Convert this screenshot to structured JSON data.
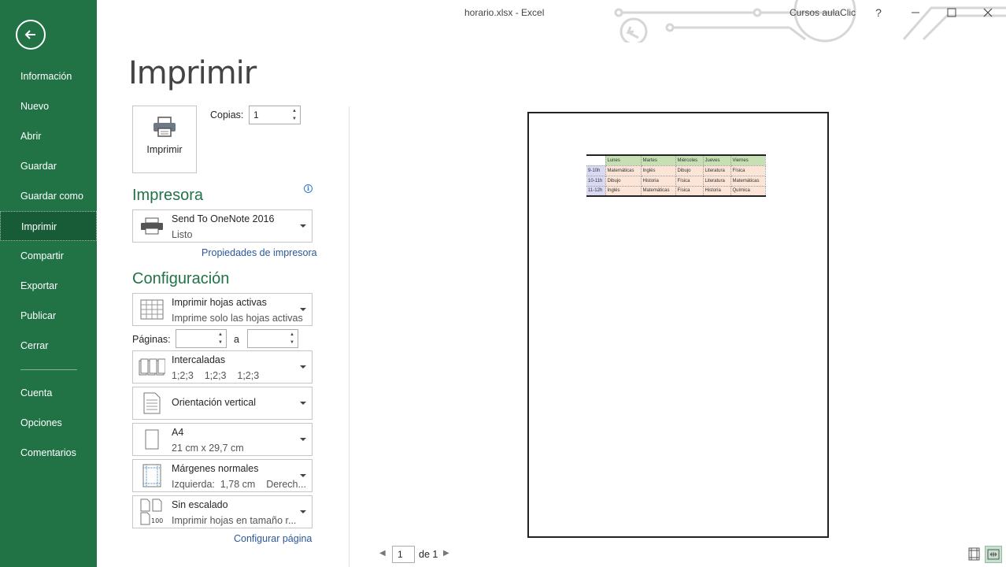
{
  "window": {
    "title": "horario.xlsx - Excel",
    "account": "Cursos aulaClic",
    "help": "?"
  },
  "sidebar": {
    "items": [
      {
        "label": "Información"
      },
      {
        "label": "Nuevo"
      },
      {
        "label": "Abrir"
      },
      {
        "label": "Guardar"
      },
      {
        "label": "Guardar como"
      },
      {
        "label": "Imprimir",
        "active": true
      },
      {
        "label": "Compartir"
      },
      {
        "label": "Exportar"
      },
      {
        "label": "Publicar"
      },
      {
        "label": "Cerrar"
      }
    ],
    "bottom_items": [
      {
        "label": "Cuenta"
      },
      {
        "label": "Opciones"
      },
      {
        "label": "Comentarios"
      }
    ]
  },
  "main": {
    "heading": "Imprimir",
    "print_button_label": "Imprimir",
    "copies_label": "Copias:",
    "copies_value": "1",
    "printer_section": "Impresora",
    "printer": {
      "name": "Send To OneNote 2016",
      "status": "Listo"
    },
    "printer_properties": "Propiedades de impresora",
    "settings_section": "Configuración",
    "settings": {
      "what": {
        "title": "Imprimir hojas activas",
        "subtitle": "Imprime solo las hojas activas"
      },
      "pages_label": "Páginas:",
      "pages_from": "",
      "pages_to_label": "a",
      "pages_to": "",
      "collate": {
        "title": "Intercaladas",
        "subtitle": "1;2;3    1;2;3    1;2;3"
      },
      "orientation": {
        "title": "Orientación vertical"
      },
      "paper": {
        "title": "A4",
        "subtitle": "21 cm x 29,7 cm"
      },
      "margins": {
        "title": "Márgenes normales",
        "subtitle": "Izquierda:  1,78 cm    Derech..."
      },
      "scaling": {
        "title": "Sin escalado",
        "subtitle": "Imprimir hojas en tamaño r..."
      }
    },
    "page_setup_link": "Configurar página"
  },
  "preview": {
    "table": {
      "headers": [
        "",
        "Lunes",
        "Martes",
        "Miércoles",
        "Jueves",
        "Viernes"
      ],
      "rows": [
        [
          "9-10h",
          "Matemáticas",
          "Inglés",
          "Dibujo",
          "Literatura",
          "Física"
        ],
        [
          "10-11h",
          "Dibujo",
          "Historia",
          "Física",
          "Literatura",
          "Matemáticas"
        ],
        [
          "11-12h",
          "Inglés",
          "Matemáticas",
          "Física",
          "Historia",
          "Química"
        ]
      ]
    },
    "pager": {
      "current": "1",
      "of_text": "de 1"
    }
  },
  "colors": {
    "accent": "#217346",
    "link": "#2b579a"
  },
  "icons": {
    "back": "back-arrow-icon",
    "printer": "printer-icon",
    "info": "info-icon"
  }
}
